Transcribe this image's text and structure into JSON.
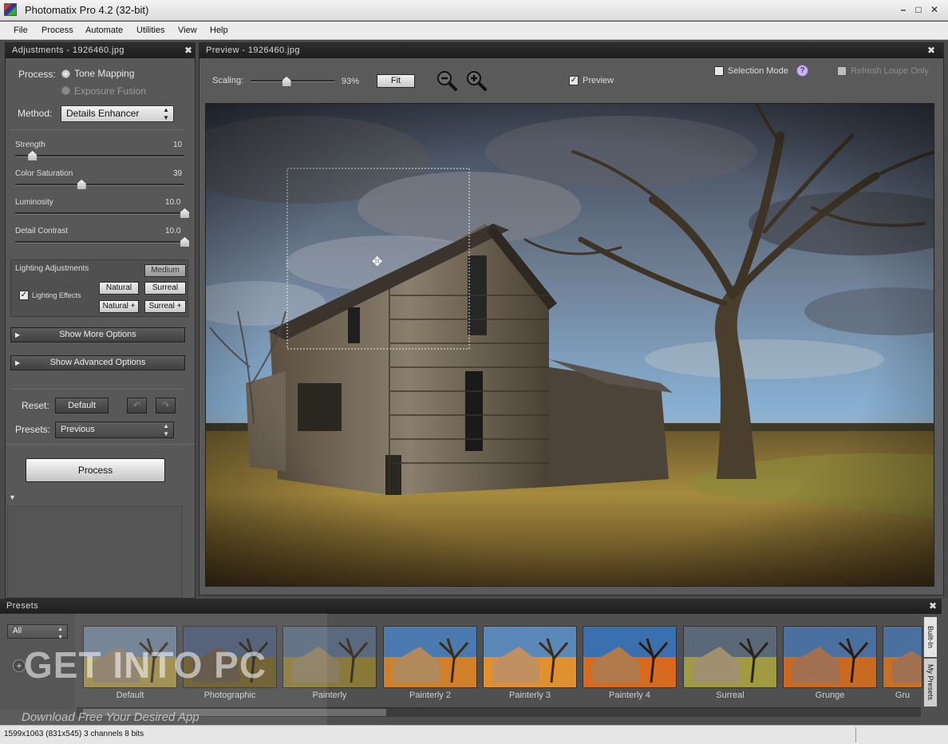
{
  "window": {
    "title": "Photomatix Pro 4.2 (32-bit)"
  },
  "menu": [
    "File",
    "Process",
    "Automate",
    "Utilities",
    "View",
    "Help"
  ],
  "adjustments": {
    "header": "Adjustments - 1926460.jpg",
    "process_label": "Process:",
    "process_options": [
      "Tone Mapping",
      "Exposure Fusion"
    ],
    "method_label": "Method:",
    "method_value": "Details Enhancer",
    "sliders": [
      {
        "label": "Strength",
        "value": "10",
        "fraction": 0.1
      },
      {
        "label": "Color Saturation",
        "value": "39",
        "fraction": 0.39
      },
      {
        "label": "Luminosity",
        "value": "10.0",
        "fraction": 1.0
      },
      {
        "label": "Detail Contrast",
        "value": "10.0",
        "fraction": 1.0
      }
    ],
    "lighting": {
      "title": "Lighting Adjustments",
      "checkbox_label": "Lighting Effects",
      "buttons": [
        "Medium",
        "Natural",
        "Surreal",
        "Natural +",
        "Surreal +"
      ]
    },
    "show_more": "Show More Options",
    "show_advanced": "Show Advanced Options",
    "reset_label": "Reset:",
    "reset_button": "Default",
    "presets_label": "Presets:",
    "presets_value": "Previous",
    "process_button": "Process"
  },
  "preview": {
    "header": "Preview - 1926460.jpg",
    "scaling_label": "Scaling:",
    "scaling_value": "93%",
    "scaling_fraction": 0.42,
    "fit_button": "Fit",
    "preview_label": "Preview",
    "selection_mode": "Selection Mode",
    "help": "?",
    "refresh_loupe": "Refresh Loupe Only"
  },
  "presets": {
    "header": "Presets",
    "filter_value": "All",
    "items": [
      "Default",
      "Photographic",
      "Painterly",
      "Painterly 2",
      "Painterly 3",
      "Painterly 4",
      "Surreal",
      "Grunge",
      "Gru"
    ],
    "tabs": [
      "Built-In",
      "My Presets"
    ]
  },
  "watermark": {
    "line1": "GET INTO PC",
    "line2": "Download Free Your Desired App"
  },
  "status": "1599x1063 (831x545) 3 channels 8 bits",
  "colors": {
    "panel": "#585858",
    "header": "#1e1e1e",
    "sky": "#6a8fb5",
    "grass": "#b08a3c"
  }
}
